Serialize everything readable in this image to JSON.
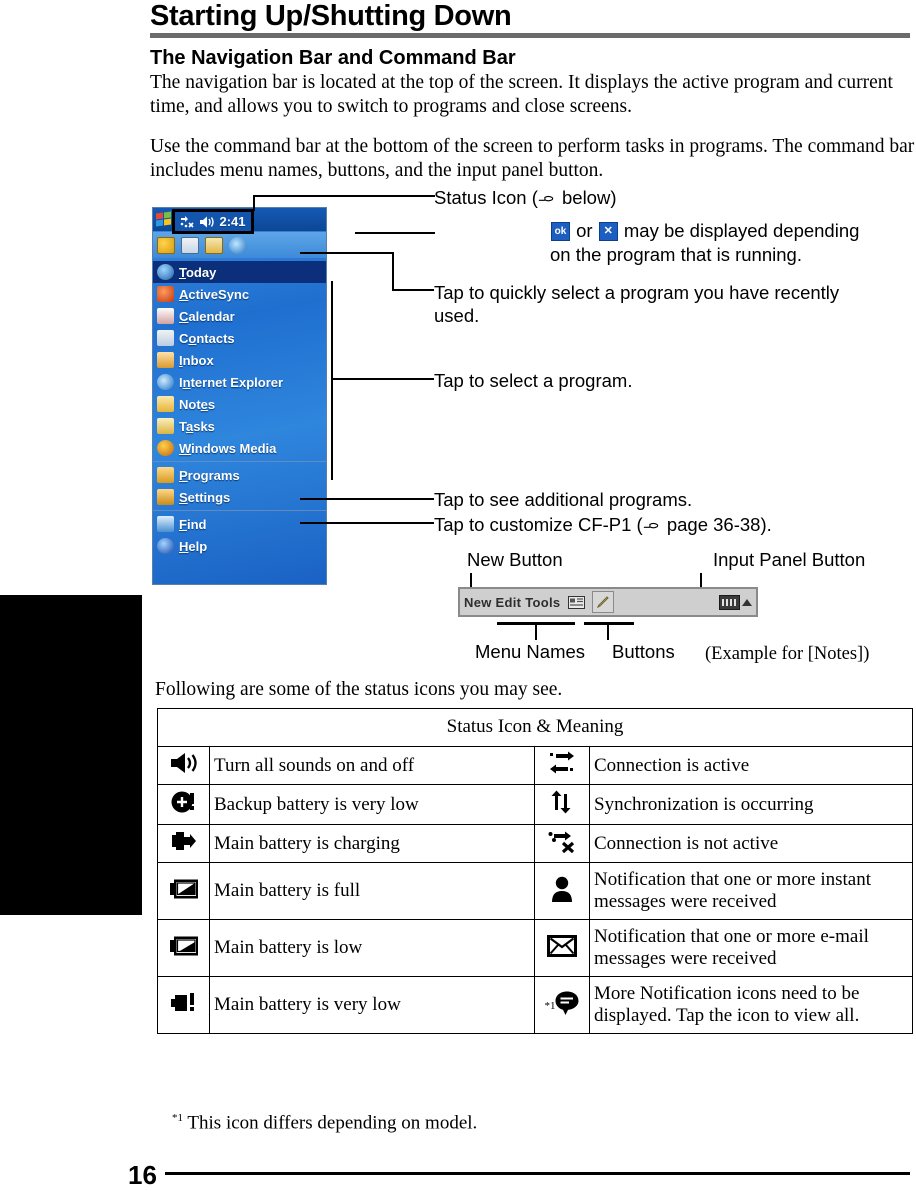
{
  "page": {
    "title": "Starting Up/Shutting Down",
    "number": "16",
    "footnote": "This icon differs depending on model.",
    "footnote_marker": "*1"
  },
  "section": {
    "heading": "The Navigation Bar and Command Bar",
    "paragraph_1": "The navigation bar is located at the top of the screen. It displays the active program and current time, and allows you to switch to programs and close screens.",
    "paragraph_2": "Use the command bar at the bottom of the screen to perform tasks in programs. The command bar includes menu names, buttons, and the input panel button.",
    "paragraph_3": "Following are some of the status icons you may see."
  },
  "pda": {
    "start_label": "Start",
    "status_time": "2:41",
    "status_icons": [
      "connection-icon",
      "speaker-icon"
    ],
    "toolbar_icons": [
      "search-icon",
      "contacts-icon",
      "tasks-icon",
      "internet-explorer-icon"
    ],
    "menu_items": [
      {
        "label": "Today",
        "accel": "T",
        "icon": "today-icon",
        "selected": true
      },
      {
        "label": "ActiveSync",
        "accel": "A",
        "icon": "activesync-icon",
        "selected": false
      },
      {
        "label": "Calendar",
        "accel": "C",
        "icon": "calendar-icon",
        "selected": false
      },
      {
        "label": "Contacts",
        "accel": "o",
        "icon": "contacts-icon",
        "selected": false
      },
      {
        "label": "Inbox",
        "accel": "I",
        "icon": "inbox-icon",
        "selected": false
      },
      {
        "label": "Internet Explorer",
        "accel": "n",
        "icon": "internet-explorer-icon",
        "selected": false
      },
      {
        "label": "Notes",
        "accel": "e",
        "icon": "notes-icon",
        "selected": false
      },
      {
        "label": "Tasks",
        "accel": "a",
        "icon": "tasks-icon",
        "selected": false
      },
      {
        "label": "Windows Media",
        "accel": "W",
        "icon": "windows-media-icon",
        "selected": false
      },
      {
        "label": "Programs",
        "accel": "P",
        "icon": "programs-icon",
        "selected": false
      },
      {
        "label": "Settings",
        "accel": "S",
        "icon": "settings-icon",
        "selected": false
      },
      {
        "label": "Find",
        "accel": "F",
        "icon": "find-icon",
        "selected": false
      },
      {
        "label": "Help",
        "accel": "H",
        "icon": "help-icon",
        "selected": false
      }
    ]
  },
  "callouts": {
    "status_icon": "Status Icon  (",
    "status_icon_tail": " below)",
    "ok_or_x_pre": "",
    "ok_or_x_mid": " or ",
    "ok_or_x_post": " may be displayed depending",
    "ok_or_x_line2": "on the program that is running.",
    "recent_line1": "Tap to quickly select a program you have recently",
    "recent_line2": "used.",
    "select_program": "Tap to select a program.",
    "additional_programs": "Tap to see additional programs.",
    "customize_pre": "Tap to customize CF-P1 (",
    "customize_post": " page 36-38)."
  },
  "command_bar": {
    "menu_names_text": "New Edit Tools",
    "label_new_button": "New Button",
    "label_input_panel_button": "Input Panel Button",
    "label_menu_names": "Menu Names",
    "label_buttons": "Buttons",
    "example_note": "(Example for [Notes])",
    "icons": [
      "card-icon",
      "pencil-icon",
      "keyboard-icon",
      "chevron-up-icon"
    ]
  },
  "status_table": {
    "header": "Status Icon & Meaning",
    "rows": [
      {
        "left_icon": "speaker-icon",
        "left_text": "Turn all sounds on and off",
        "right_icon": "connection-active-icon",
        "right_text": "Connection is active",
        "right_marker": ""
      },
      {
        "left_icon": "backup-battery-very-low-icon",
        "left_text": "Backup battery is very low",
        "right_icon": "sync-icon",
        "right_text": "Synchronization is occurring",
        "right_marker": ""
      },
      {
        "left_icon": "battery-charging-icon",
        "left_text": "Main battery is charging",
        "right_icon": "connection-inactive-icon",
        "right_text": "Connection is not active",
        "right_marker": ""
      },
      {
        "left_icon": "battery-full-icon",
        "left_text": "Main battery is full",
        "right_icon": "person-icon",
        "right_text": "Notification that one or more instant messages were received",
        "right_marker": ""
      },
      {
        "left_icon": "battery-low-icon",
        "left_text": "Main battery is low",
        "right_icon": "envelope-icon",
        "right_text": "Notification that one or more e-mail messages were received",
        "right_marker": ""
      },
      {
        "left_icon": "battery-very-low-icon",
        "left_text": "Main battery is very low",
        "right_icon": "speech-bubble-icon",
        "right_text": "More Notification icons need to be displayed. Tap the icon to view all.",
        "right_marker": "*1"
      }
    ]
  },
  "colors": {
    "title_rule": "#6b6b6b",
    "pda_titlebar": "#0d4794",
    "pda_selected": "#0b2f7a",
    "command_bar_bg": "#cfcfcf"
  }
}
